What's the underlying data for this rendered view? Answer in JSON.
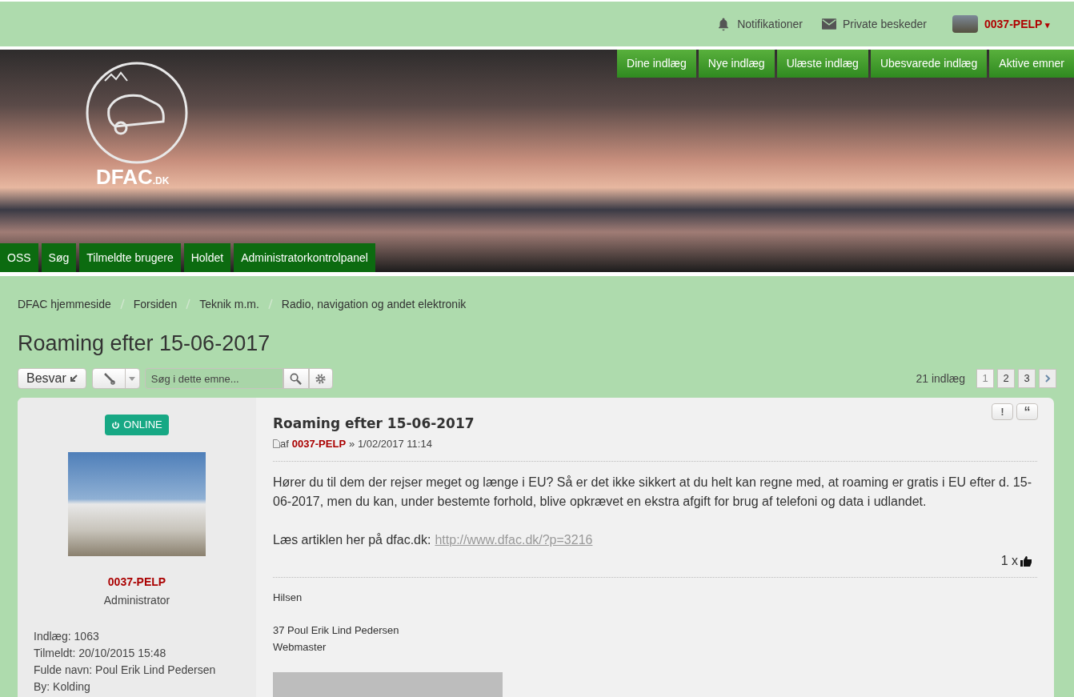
{
  "top_bar": {
    "items": [
      {
        "kind": "bell",
        "label": "Notifikationer"
      },
      {
        "kind": "mail",
        "label": "Private beskeder"
      }
    ],
    "user": {
      "name": "0037-PELP",
      "caret": "▾"
    }
  },
  "banner": {
    "logo_text": "DFAC",
    "logo_suffix": ".DK",
    "quick_links": [
      "Dine indlæg",
      "Nye indlæg",
      "Ulæste indlæg",
      "Ubesvarede indlæg",
      "Aktive emner"
    ],
    "nav_tabs": [
      "OSS",
      "Søg",
      "Tilmeldte brugere",
      "Holdet",
      "Administratorkontrolpanel"
    ]
  },
  "breadcrumbs": [
    "DFAC hjemmeside",
    "Forsiden",
    "Teknik m.m.",
    "Radio, navigation og andet elektronik"
  ],
  "topic_title": "Roaming efter 15-06-2017",
  "toolbar": {
    "reply_label": "Besvar",
    "search_placeholder": "Søg i dette emne...",
    "post_count": "21 indlæg",
    "pages": [
      {
        "label": "1",
        "selected": true
      },
      {
        "label": "2",
        "selected": false
      },
      {
        "label": "3",
        "selected": false
      }
    ]
  },
  "post": {
    "author": {
      "online": true,
      "online_label": "ONLINE",
      "name": "0037-PELP",
      "rank": "Administrator",
      "details": [
        "Indlæg: 1063",
        "Tilmeldt: 20/10/2015 15:48",
        "Fulde navn: Poul Erik Lind Pedersen",
        "By: Kolding"
      ]
    },
    "title": "Roaming efter 15-06-2017",
    "by_prefix": "af",
    "by_name": "0037-PELP",
    "date": "» 1/02/2017 11:14",
    "report_label": "!",
    "quote_label": "“",
    "paragraphs": [
      "Hører du til dem der rejser meget og længe i EU? Så er det ikke sikkert at du helt kan regne med, at roaming er gratis i EU efter d. 15-06-2017, men du kan, under bestemte forhold, blive opkrævet en ekstra afgift for brug af telefoni og data i udlandet."
    ],
    "link_prefix": "Læs artiklen her på dfac.dk:",
    "link": "http://www.dfac.dk/?p=3216",
    "likes": "1 x",
    "signature": [
      "Hilsen",
      "37 Poul Erik Lind Pedersen",
      "Webmaster"
    ]
  }
}
